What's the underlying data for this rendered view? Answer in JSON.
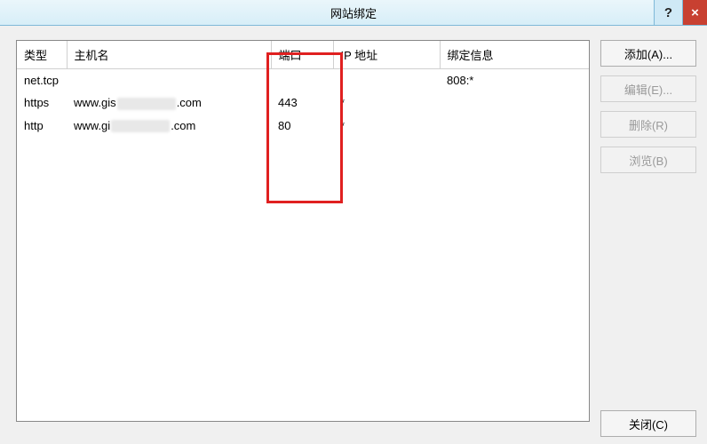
{
  "title": "网站绑定",
  "help_symbol": "?",
  "close_symbol": "×",
  "columns": {
    "type": "类型",
    "host": "主机名",
    "port": "端口",
    "ip": "IP 地址",
    "bind": "绑定信息"
  },
  "rows": [
    {
      "type": "net.tcp",
      "host_pre": "",
      "host_post": "",
      "censored": false,
      "port": "",
      "ip": "",
      "bind": "808:*"
    },
    {
      "type": "https",
      "host_pre": "www.gis",
      "host_post": ".com",
      "censored": true,
      "port": "443",
      "ip": "*",
      "bind": ""
    },
    {
      "type": "http",
      "host_pre": "www.gi",
      "host_post": ".com",
      "censored": true,
      "port": "80",
      "ip": "*",
      "bind": ""
    }
  ],
  "buttons": {
    "add": "添加(A)...",
    "edit": "编辑(E)...",
    "remove": "删除(R)",
    "browse": "浏览(B)",
    "close": "关闭(C)"
  }
}
